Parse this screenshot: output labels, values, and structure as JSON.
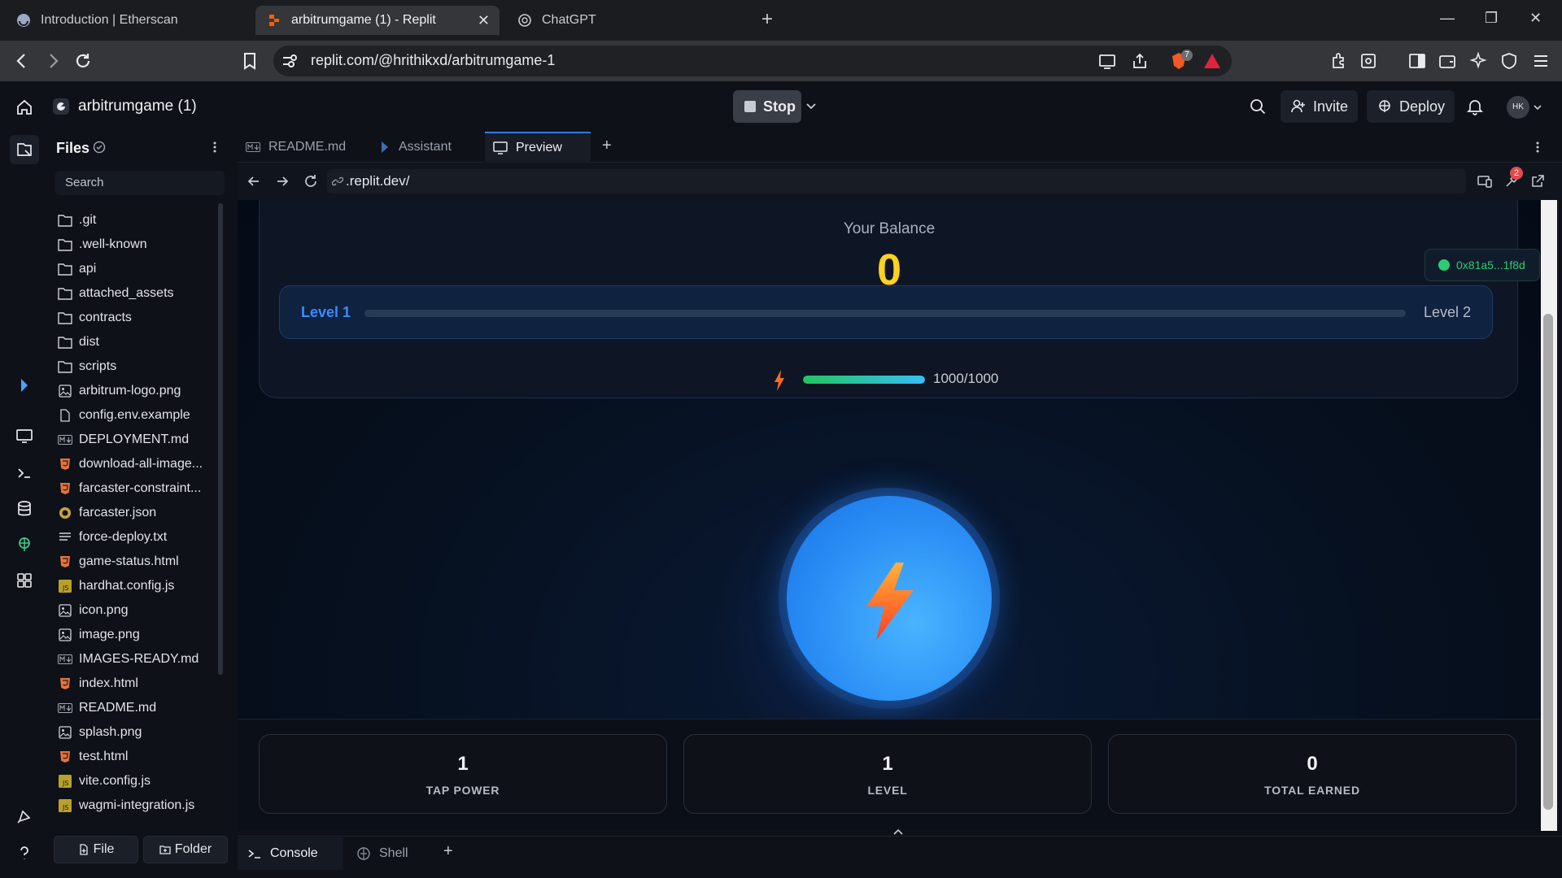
{
  "browser": {
    "tabs": [
      {
        "title": "Introduction | Etherscan"
      },
      {
        "title": "arbitrumgame (1) - Replit"
      },
      {
        "title": "ChatGPT"
      }
    ],
    "url": "replit.com/@hrithikxd/arbitrumgame-1",
    "extension_badge": "7"
  },
  "header": {
    "project": "arbitrumgame (1)",
    "stop_label": "Stop",
    "invite_label": "Invite",
    "deploy_label": "Deploy",
    "avatar_initials": "HK"
  },
  "files": {
    "title": "Files",
    "search_placeholder": "Search",
    "items": [
      {
        "name": ".git",
        "icon": "folder-icon"
      },
      {
        "name": ".well-known",
        "icon": "folder-icon"
      },
      {
        "name": "api",
        "icon": "folder-icon"
      },
      {
        "name": "attached_assets",
        "icon": "folder-icon"
      },
      {
        "name": "contracts",
        "icon": "folder-icon"
      },
      {
        "name": "dist",
        "icon": "folder-icon"
      },
      {
        "name": "scripts",
        "icon": "folder-icon"
      },
      {
        "name": "arbitrum-logo.png",
        "icon": "image-icon"
      },
      {
        "name": "config.env.example",
        "icon": "file-icon"
      },
      {
        "name": "DEPLOYMENT.md",
        "icon": "markdown-icon"
      },
      {
        "name": "download-all-image...",
        "icon": "html-icon"
      },
      {
        "name": "farcaster-constraint...",
        "icon": "html-icon"
      },
      {
        "name": "farcaster.json",
        "icon": "json-icon"
      },
      {
        "name": "force-deploy.txt",
        "icon": "text-icon"
      },
      {
        "name": "game-status.html",
        "icon": "html-icon"
      },
      {
        "name": "hardhat.config.js",
        "icon": "js-icon"
      },
      {
        "name": "icon.png",
        "icon": "image-icon"
      },
      {
        "name": "image.png",
        "icon": "image-icon"
      },
      {
        "name": "IMAGES-READY.md",
        "icon": "markdown-icon"
      },
      {
        "name": "index.html",
        "icon": "html-icon"
      },
      {
        "name": "README.md",
        "icon": "markdown-icon"
      },
      {
        "name": "splash.png",
        "icon": "image-icon"
      },
      {
        "name": "test.html",
        "icon": "html-icon"
      },
      {
        "name": "vite.config.js",
        "icon": "js-icon"
      },
      {
        "name": "wagmi-integration.js",
        "icon": "js-icon"
      }
    ],
    "new_file_label": "File",
    "new_folder_label": "Folder"
  },
  "editor_tabs": [
    {
      "label": "README.md"
    },
    {
      "label": "Assistant"
    },
    {
      "label": "Preview"
    }
  ],
  "preview": {
    "url": ".replit.dev/",
    "badge": "2"
  },
  "game": {
    "balance_label": "Your Balance",
    "balance_value": "0",
    "wallet": "0x81a5...1f8d",
    "level_current": "Level 1",
    "level_next": "Level 2",
    "level_progress": 0,
    "energy_text": "1000/1000",
    "energy_fraction": 1.0,
    "stats": [
      {
        "value": "1",
        "label": "TAP POWER"
      },
      {
        "value": "1",
        "label": "LEVEL"
      },
      {
        "value": "0",
        "label": "TOTAL EARNED"
      }
    ]
  },
  "console_tabs": [
    {
      "label": "Console"
    },
    {
      "label": "Shell"
    }
  ],
  "colors": {
    "accent": "#2f7bf5",
    "balance": "#ffd21f",
    "wallet_green": "#2ecc71"
  }
}
